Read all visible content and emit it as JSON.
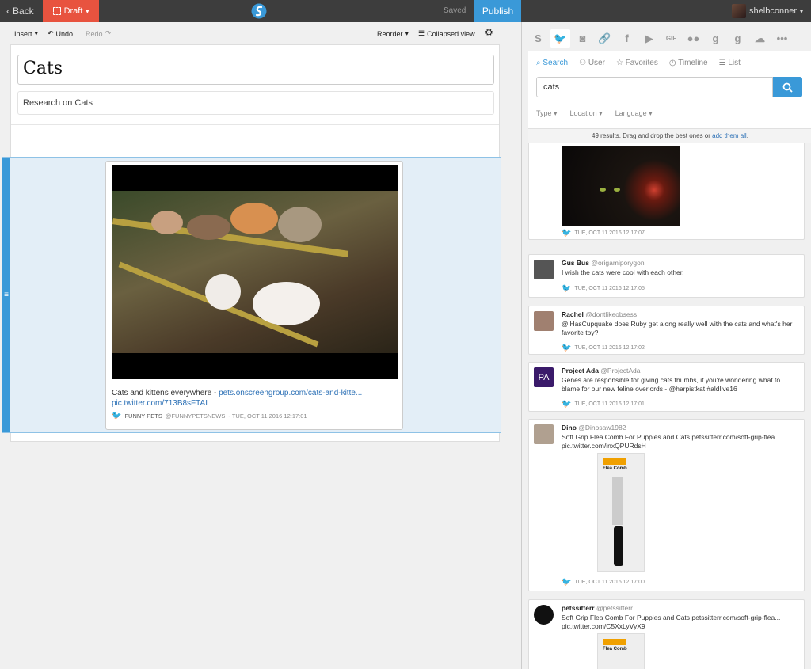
{
  "topbar": {
    "back_label": "Back",
    "draft_label": "Draft",
    "saved_label": "Saved",
    "publish_label": "Publish",
    "username": "shelbconner"
  },
  "toolbar": {
    "insert_label": "Insert",
    "undo_label": "Undo",
    "redo_label": "Redo",
    "reorder_label": "Reorder",
    "collapsed_label": "Collapsed view"
  },
  "story": {
    "title": "Cats",
    "subtitle": "Research on Cats",
    "card": {
      "caption_text": "Cats and kittens everywhere - ",
      "caption_link": "pets.onscreengroup.com/cats-and-kitte...",
      "caption_pic": "pic.twitter.com/713B8sFTAI",
      "author": "FUNNY PETS",
      "handle": "@FUNNYPETSNEWS",
      "date": " - TUE, OCT 11 2016 12:17:01"
    }
  },
  "sidebar": {
    "tabs": [
      "Search",
      "User",
      "Favorites",
      "Timeline",
      "List"
    ],
    "query": "cats",
    "filters": [
      "Type",
      "Location",
      "Language"
    ],
    "results_text": "49 results. Drag and drop the best ones or ",
    "results_link": "add them all",
    "results_end": "."
  },
  "tweets": [
    {
      "name": "",
      "handle": "",
      "text": "",
      "date": "TUE, OCT 11 2016 12:17:07"
    },
    {
      "name": "Gus Bus",
      "handle": "@origamiporygon",
      "text": "I wish the cats were cool with each other.",
      "date": "TUE, OCT 11 2016 12:17:05"
    },
    {
      "name": "Rachel",
      "handle": "@dontlikeobsess",
      "text": "@iHasCupquake does Ruby get along really well with the cats and what's her favorite toy?",
      "date": "TUE, OCT 11 2016 12:17:02"
    },
    {
      "name": "Project Ada",
      "handle": "@ProjectAda_",
      "text": "Genes are responsible for giving cats thumbs, if you're wondering what to blame for our new feline overlords - @harpistkat #aldlive16",
      "date": "TUE, OCT 11 2016 12:17:01",
      "avatar_text": "PA"
    },
    {
      "name": "Dino",
      "handle": "@Dinosaw1982",
      "text": "Soft Grip Flea Comb For Puppies and Cats petssitterr.com/soft-grip-flea... pic.twitter.com/inxQPURdsH",
      "date": "TUE, OCT 11 2016 12:17:00",
      "product_brand": "Flea Comb"
    },
    {
      "name": "petssitterr",
      "handle": "@petssitterr",
      "text": "Soft Grip Flea Comb For Puppies and Cats petssitterr.com/soft-grip-flea... pic.twitter.com/C5XxLyVyX9",
      "date": "",
      "product_brand": "Flea Comb"
    }
  ],
  "colors": {
    "accent": "#3a99d8",
    "draft": "#e8533f",
    "topbar": "#3d3d3d"
  }
}
